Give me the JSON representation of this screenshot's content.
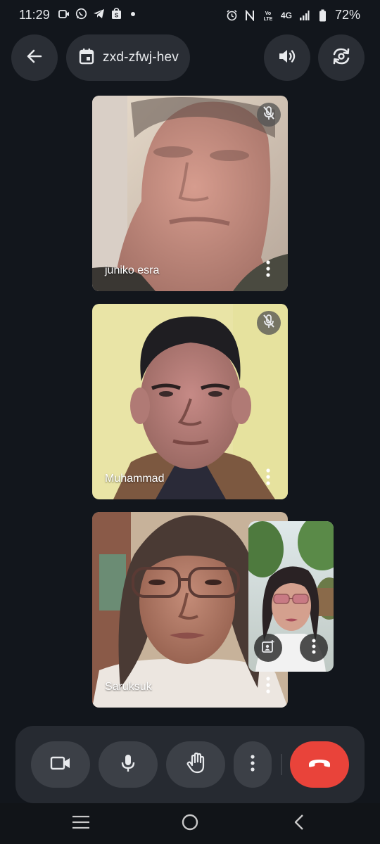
{
  "status_bar": {
    "time": "11:29",
    "network": "4G",
    "battery": "72%",
    "left_icons": [
      "video-recorder-icon",
      "whatsapp-icon",
      "telegram-icon",
      "shopee-icon",
      "notification-dot"
    ],
    "right_icons": [
      "alarm-icon",
      "nfc-icon",
      "volte-icon",
      "signal-icon",
      "battery-icon"
    ]
  },
  "header": {
    "meeting_code": "zxd-zfwj-hev",
    "icons": [
      "back-arrow-icon",
      "calendar-icon",
      "speaker-icon",
      "switch-camera-icon"
    ]
  },
  "participants": [
    {
      "name": "juniko esra",
      "muted": true
    },
    {
      "name": "Muhammad",
      "muted": true
    },
    {
      "name": "Saruksuk",
      "muted": false
    }
  ],
  "self_view": {
    "icons": [
      "add-effects-icon",
      "more-vert-icon"
    ]
  },
  "controls": {
    "buttons": [
      "camera-icon",
      "microphone-icon",
      "raise-hand-icon",
      "more-vert-icon",
      "hang-up-icon"
    ]
  },
  "colors": {
    "background": "#12161c",
    "button_bg": "#3c4047",
    "end_call": "#e9433a"
  },
  "nav_bar": {
    "buttons": [
      "recents-icon",
      "home-icon",
      "back-icon"
    ]
  }
}
